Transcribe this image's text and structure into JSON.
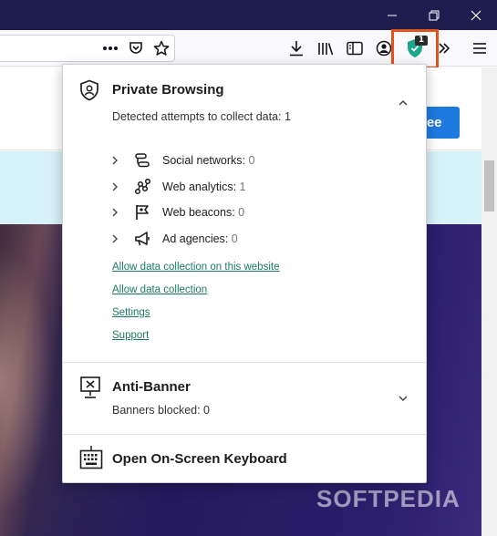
{
  "toolbar": {
    "extension_badge": "1"
  },
  "page": {
    "button_text": "ree",
    "watermark": "SOFTPEDIA"
  },
  "popup": {
    "private_browsing": {
      "title": "Private Browsing",
      "summary": "Detected attempts to collect data: 1",
      "categories": [
        {
          "label": "Social networks:",
          "count": "0",
          "icon": "social-networks-icon"
        },
        {
          "label": "Web analytics:",
          "count": "1",
          "icon": "web-analytics-icon"
        },
        {
          "label": "Web beacons:",
          "count": "0",
          "icon": "web-beacons-icon"
        },
        {
          "label": "Ad agencies:",
          "count": "0",
          "icon": "ad-agencies-icon"
        }
      ],
      "links": [
        "Allow data collection on this website",
        "Allow data collection",
        "Settings",
        "Support"
      ]
    },
    "anti_banner": {
      "title": "Anti-Banner",
      "summary": "Banners blocked: 0"
    },
    "keyboard": {
      "title": "Open On-Screen Keyboard"
    }
  },
  "colors": {
    "titlebar": "#1f1c4f",
    "link": "#1c7a63",
    "highlight": "#e0541e",
    "page_button": "#1f7ae0",
    "extension_shield": "#1aa78a"
  }
}
